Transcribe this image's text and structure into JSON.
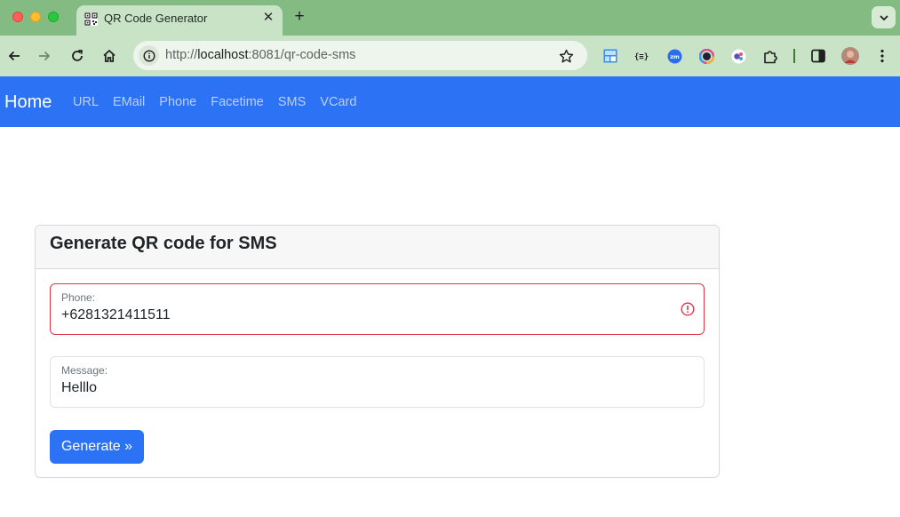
{
  "browser": {
    "tab": {
      "title": "QR Code Generator",
      "close_glyph": "✕",
      "favicon": "qr-favicon"
    },
    "new_tab_glyph": "+",
    "address": {
      "protocol": "http://",
      "host": "localhost",
      "path": ":8081/qr-code-sms"
    },
    "extensions": [
      "window-layout-icon",
      "json-viewer-icon",
      "zoom-icon",
      "color-picker-icon",
      "extension-badge-icon",
      "extensions-puzzle-icon"
    ],
    "colors": {
      "tabstrip": "#84bb82",
      "toolbar": "#c9e3c7"
    }
  },
  "nav": {
    "brand": "Home",
    "links": [
      "URL",
      "EMail",
      "Phone",
      "Facetime",
      "SMS",
      "VCard"
    ],
    "color": "#2c72f5"
  },
  "form": {
    "title": "Generate QR code for SMS",
    "phone": {
      "label": "Phone:",
      "value": "+6281321411511",
      "invalid": true
    },
    "message": {
      "label": "Message:",
      "value": "Helllo"
    },
    "submit_label": "Generate »",
    "accent": "#2c72f5",
    "error_color": "#dc3545"
  }
}
